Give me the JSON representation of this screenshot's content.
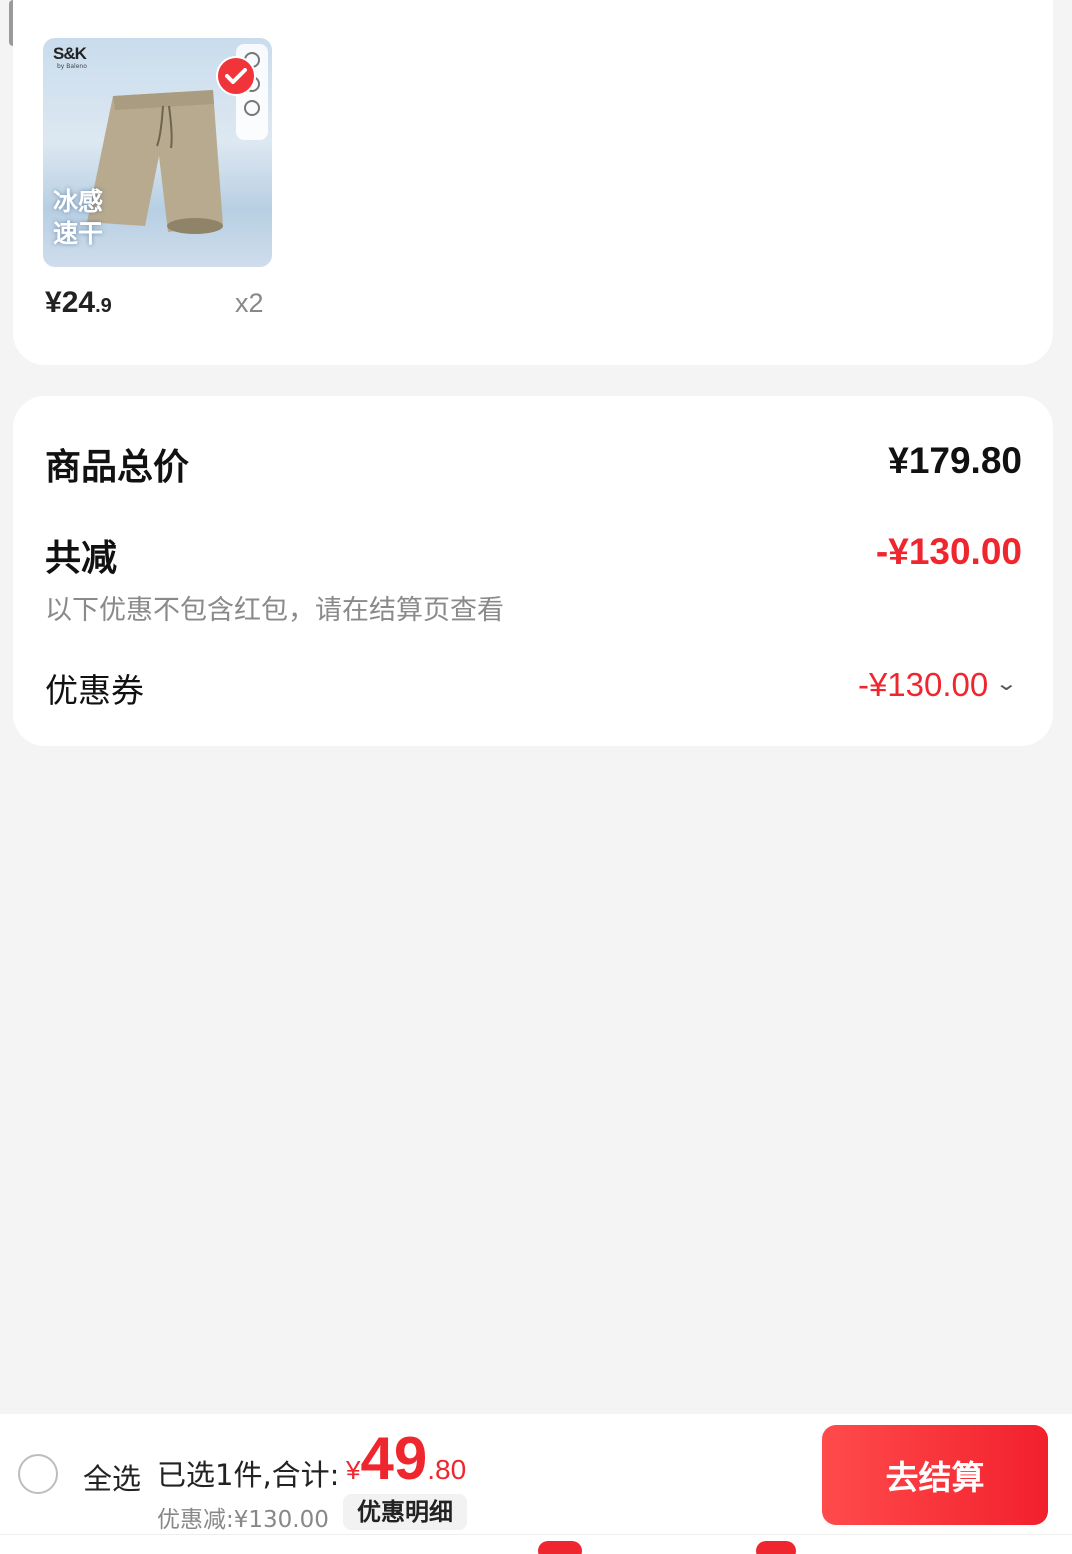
{
  "product": {
    "brand": "S&K",
    "brand_sub": "by Baleno",
    "promo_text": "冰感速干",
    "price_symbol": "¥",
    "price_int": "24",
    "price_dec": ".9",
    "quantity": "x2",
    "selected": true
  },
  "summary": {
    "total_label": "商品总价",
    "total_value": "¥179.80",
    "reduce_label": "共减",
    "reduce_value": "-¥130.00",
    "note": "以下优惠不包含红包，请在结算页查看",
    "coupon_label": "优惠券",
    "coupon_value": "-¥130.00"
  },
  "bottom_bar": {
    "select_all": "全选",
    "selected_text": "已选1件,合计:",
    "total_symbol": "¥",
    "total_int": "49",
    "total_dec": ".80",
    "discount_line": "优惠减:¥130.00",
    "detail_button": "优惠明细",
    "checkout_button": "去结算"
  },
  "colors": {
    "accent_red": "#f0262f",
    "background": "#f4f4f4"
  }
}
